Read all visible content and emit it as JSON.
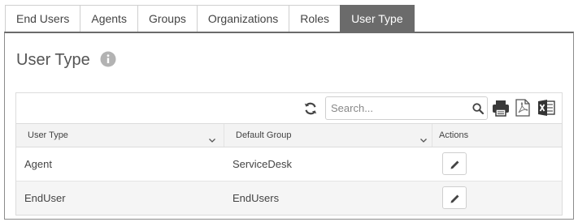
{
  "tabs": [
    {
      "label": "End Users",
      "active": false
    },
    {
      "label": "Agents",
      "active": false
    },
    {
      "label": "Groups",
      "active": false
    },
    {
      "label": "Organizations",
      "active": false
    },
    {
      "label": "Roles",
      "active": false
    },
    {
      "label": "User Type",
      "active": true
    }
  ],
  "page": {
    "title": "User Type",
    "info_icon": "info-circle-icon"
  },
  "toolbar": {
    "refresh_icon": "refresh-icon",
    "search_placeholder": "Search...",
    "search_value": "",
    "search_icon": "magnifier-icon",
    "print_icon": "printer-icon",
    "pdf_icon": "pdf-export-icon",
    "excel_icon": "excel-export-icon"
  },
  "table": {
    "columns": [
      {
        "label": "User Type",
        "sortable": true
      },
      {
        "label": "Default Group",
        "sortable": true
      },
      {
        "label": "Actions",
        "sortable": false
      }
    ],
    "rows": [
      {
        "user_type": "Agent",
        "default_group": "ServiceDesk",
        "action_icon": "pencil-icon"
      },
      {
        "user_type": "EndUser",
        "default_group": "EndUsers",
        "action_icon": "pencil-icon"
      }
    ]
  },
  "colors": {
    "active_tab": "#6b6b6b",
    "header_bg": "#f3f3f3",
    "alt_row_bg": "#f5f5f5",
    "border": "#cfcfcf"
  }
}
